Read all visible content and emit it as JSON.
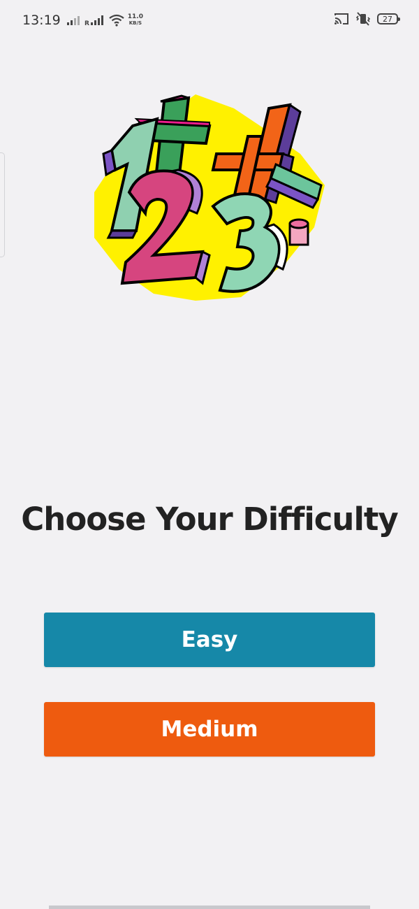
{
  "status_bar": {
    "time": "13:19",
    "net_speed_value": "11.0",
    "net_speed_unit": "KB/S",
    "battery_level": "27",
    "icons": [
      "signal-icon",
      "roaming-signal-icon",
      "wifi-icon",
      "cast-icon",
      "vibrate-icon",
      "battery-icon"
    ]
  },
  "hero": {
    "image_name": "numbers-illustration",
    "digits": [
      "1",
      "2",
      "3",
      "4",
      "+",
      "-"
    ]
  },
  "main": {
    "title": "Choose Your Difficulty",
    "buttons": [
      {
        "label": "Easy",
        "color": "#1688a8"
      },
      {
        "label": "Medium",
        "color": "#ee5b0f"
      }
    ]
  },
  "colors": {
    "background": "#f2f1f3",
    "title_text": "#222222",
    "button_text": "#ffffff"
  }
}
